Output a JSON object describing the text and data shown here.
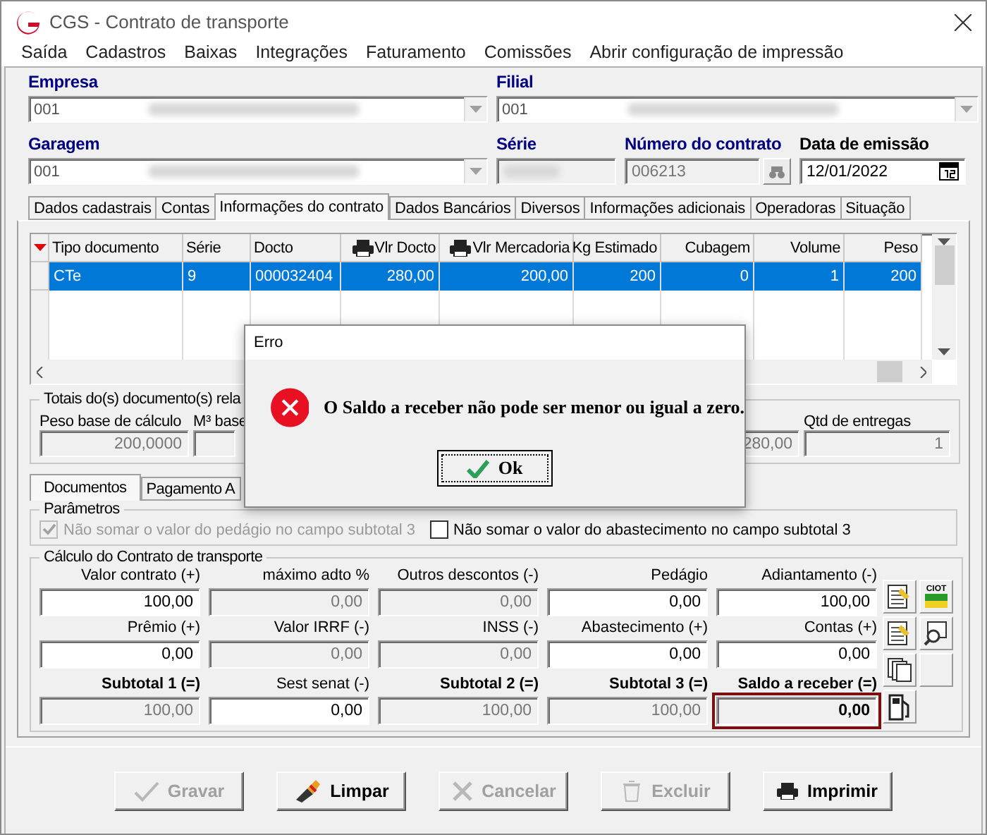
{
  "window": {
    "title": "CGS - Contrato de transporte"
  },
  "menu": [
    "Saída",
    "Cadastros",
    "Baixas",
    "Integrações",
    "Faturamento",
    "Comissões",
    "Abrir configuração de impressão"
  ],
  "header_rows": [
    [
      {
        "label": "Empresa",
        "required": true,
        "kind": "combo",
        "value": "001"
      },
      {
        "label": "Filial",
        "required": true,
        "kind": "combo",
        "value": "001"
      }
    ],
    [
      {
        "label": "Garagem",
        "required": true,
        "kind": "combo",
        "value": "001"
      },
      {
        "label": "Série",
        "required": true,
        "kind": "text"
      },
      {
        "label": "Número do contrato",
        "required": true,
        "kind": "lookup",
        "value": "006213"
      },
      {
        "label": "Data de emissão",
        "required": false,
        "kind": "date",
        "value": "12/01/2022"
      }
    ]
  ],
  "tabs": [
    {
      "label": "Dados cadastrais",
      "selected": false
    },
    {
      "label": "Contas",
      "selected": false
    },
    {
      "label": "Informações do contrato",
      "selected": true
    },
    {
      "label": "Dados Bancários",
      "selected": false
    },
    {
      "label": "Diversos",
      "selected": false
    },
    {
      "label": "Informações adicionais",
      "selected": false
    },
    {
      "label": "Operadoras",
      "selected": false
    },
    {
      "label": "Situação",
      "selected": false
    }
  ],
  "documents_table": {
    "columns": [
      {
        "label": "Tipo documento",
        "numeric": false,
        "print_icon": false
      },
      {
        "label": "Série",
        "numeric": false,
        "print_icon": false
      },
      {
        "label": "Docto",
        "numeric": false,
        "print_icon": false
      },
      {
        "label": "Vlr Docto",
        "numeric": true,
        "print_icon": true
      },
      {
        "label": "Vlr Mercadoria",
        "numeric": true,
        "print_icon": true
      },
      {
        "label": "Kg Estimado",
        "numeric": true,
        "print_icon": false
      },
      {
        "label": "Cubagem",
        "numeric": true,
        "print_icon": false
      },
      {
        "label": "Volume",
        "numeric": true,
        "print_icon": false
      },
      {
        "label": "Peso",
        "numeric": true,
        "print_icon": false
      }
    ],
    "rows": [
      {
        "selected": true,
        "cells": [
          "CTe",
          "9",
          "000032404",
          "280,00",
          "200,00",
          "200",
          "0",
          "1",
          "200"
        ]
      }
    ]
  },
  "totals": {
    "title": "Totais do(s) documento(s) rela",
    "fields": [
      {
        "label": "Peso base de cálculo",
        "value": "200,0000"
      },
      {
        "label": "M³ base"
      },
      {
        "value": "280,00"
      },
      {
        "label": "Qtd de entregas",
        "value": "1"
      }
    ]
  },
  "inner_tabs": [
    {
      "label": "Documentos",
      "selected": true
    },
    {
      "label": "Pagamento A",
      "selected": false
    }
  ],
  "parameters": {
    "title": "Parâmetros",
    "options": [
      {
        "label": "Não somar o valor do pedágio no campo subtotal 3",
        "checked": true,
        "disabled": true
      },
      {
        "label": "Não somar o valor do abastecimento no campo subtotal 3",
        "checked": false,
        "disabled": false
      }
    ]
  },
  "calculation": {
    "title": "Cálculo do Contrato de transporte",
    "rows": [
      [
        {
          "label": "Valor contrato (+)",
          "value": "100,00",
          "editable": true,
          "bold": false,
          "highlighted": false
        },
        {
          "label": "máximo adto %",
          "value": "0,00",
          "editable": false,
          "bold": false,
          "highlighted": false
        },
        {
          "label": "Outros descontos (-)",
          "value": "0,00",
          "editable": false,
          "bold": false,
          "highlighted": false
        },
        {
          "label": "Pedágio",
          "value": "0,00",
          "editable": true,
          "bold": false,
          "highlighted": false
        },
        {
          "label": "Adiantamento (-)",
          "value": "100,00",
          "editable": true,
          "bold": false,
          "highlighted": false
        }
      ],
      [
        {
          "label": "Prêmio (+)",
          "value": "0,00",
          "editable": true,
          "bold": false,
          "highlighted": false
        },
        {
          "label": "Valor IRRF (-)",
          "value": "0,00",
          "editable": false,
          "bold": false,
          "highlighted": false
        },
        {
          "label": "INSS (-)",
          "value": "0,00",
          "editable": false,
          "bold": false,
          "highlighted": false
        },
        {
          "label": "Abastecimento (+)",
          "value": "0,00",
          "editable": true,
          "bold": false,
          "highlighted": false
        },
        {
          "label": "Contas (+)",
          "value": "0,00",
          "editable": true,
          "bold": false,
          "highlighted": false
        }
      ],
      [
        {
          "label": "Subtotal 1 (=)",
          "value": "100,00",
          "editable": false,
          "bold": true,
          "highlighted": false
        },
        {
          "label": "Sest senat (-)",
          "value": "0,00",
          "editable": true,
          "bold": false,
          "highlighted": false
        },
        {
          "label": "Subtotal 2 (=)",
          "value": "100,00",
          "editable": false,
          "bold": true,
          "highlighted": false
        },
        {
          "label": "Subtotal 3 (=)",
          "value": "100,00",
          "editable": false,
          "bold": true,
          "highlighted": false
        },
        {
          "label": "Saldo a receber (=)",
          "value": "0,00",
          "editable": false,
          "bold": true,
          "highlighted": true
        }
      ]
    ]
  },
  "side_buttons": [
    {
      "kind": "sheet"
    },
    {
      "kind": "ciot",
      "label": "CIOT"
    },
    {
      "kind": "sheet"
    },
    {
      "kind": "search"
    },
    {
      "kind": "pages"
    },
    {
      "kind": "blank"
    },
    {
      "kind": "fuel"
    }
  ],
  "buttons": [
    {
      "label": "Gravar",
      "kind": "save",
      "disabled": true
    },
    {
      "label": "Limpar",
      "kind": "clear",
      "disabled": false
    },
    {
      "label": "Cancelar",
      "kind": "cancel",
      "disabled": true
    },
    {
      "label": "Excluir",
      "kind": "delete",
      "disabled": true
    },
    {
      "label": "Imprimir",
      "kind": "print",
      "disabled": false
    }
  ],
  "dialog": {
    "title": "Erro",
    "message": "O Saldo a receber não pode ser menor ou igual a zero.",
    "button": "Ok"
  }
}
